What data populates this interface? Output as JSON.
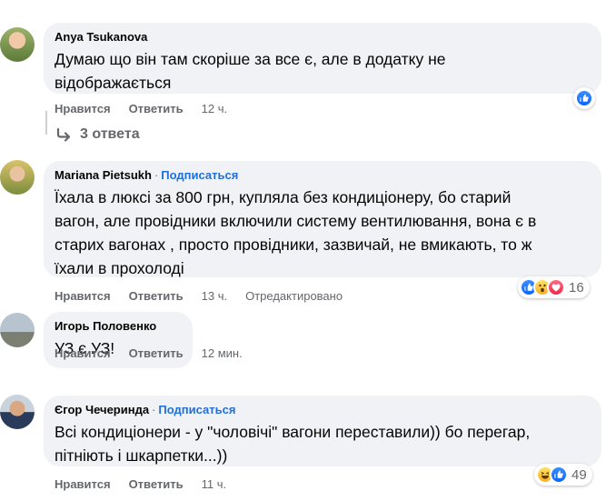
{
  "comments": [
    {
      "author": "Anya Tsukanova",
      "follow": "",
      "text": "Думаю що він там скоріше за все є, але в додатку не\nвідображається",
      "actions": {
        "like": "Нравится",
        "reply": "Ответить",
        "time": "12 ч.",
        "edited": ""
      },
      "reactions": {
        "icons": [
          "like-icon"
        ],
        "count": ""
      }
    },
    {
      "author": "Mariana Pietsukh",
      "follow": "Подписаться",
      "text": "Їхала в люксі за 800 грн, купляла без кондиціонеру, бо старий\nвагон, але провідники включили систему вентилювання, вона є в\nстарих вагонах , просто провідники, зазвичай, не вмикають, то ж\nїхали в прохолоді",
      "actions": {
        "like": "Нравится",
        "reply": "Ответить",
        "time": "13 ч.",
        "edited": "Отредактировано"
      },
      "reactions": {
        "icons": [
          "like-icon",
          "wow-icon",
          "love-icon"
        ],
        "count": "16"
      }
    },
    {
      "author": "Игорь Половенко",
      "follow": "",
      "text": "УЗ є УЗ!",
      "actions": {
        "like": "Нравится",
        "reply": "Ответить",
        "time": "12 мин.",
        "edited": ""
      },
      "reactions": {
        "icons": [],
        "count": ""
      }
    },
    {
      "author": "Єгор Чечеринда",
      "follow": "Подписаться",
      "text": "Всі кондиціонери - у \"чоловічі\" вагони переставили)) бо перегар,\nпітніють і шкарпетки...))",
      "actions": {
        "like": "Нравится",
        "reply": "Ответить",
        "time": "11 ч.",
        "edited": ""
      },
      "reactions": {
        "icons": [
          "haha-icon",
          "like-icon"
        ],
        "count": "49"
      }
    }
  ],
  "replies_link": "3 ответа",
  "colors": {
    "bubble": "#f0f2f5",
    "link": "#216fdb",
    "muted": "#65676b",
    "like": "#0866ff"
  }
}
